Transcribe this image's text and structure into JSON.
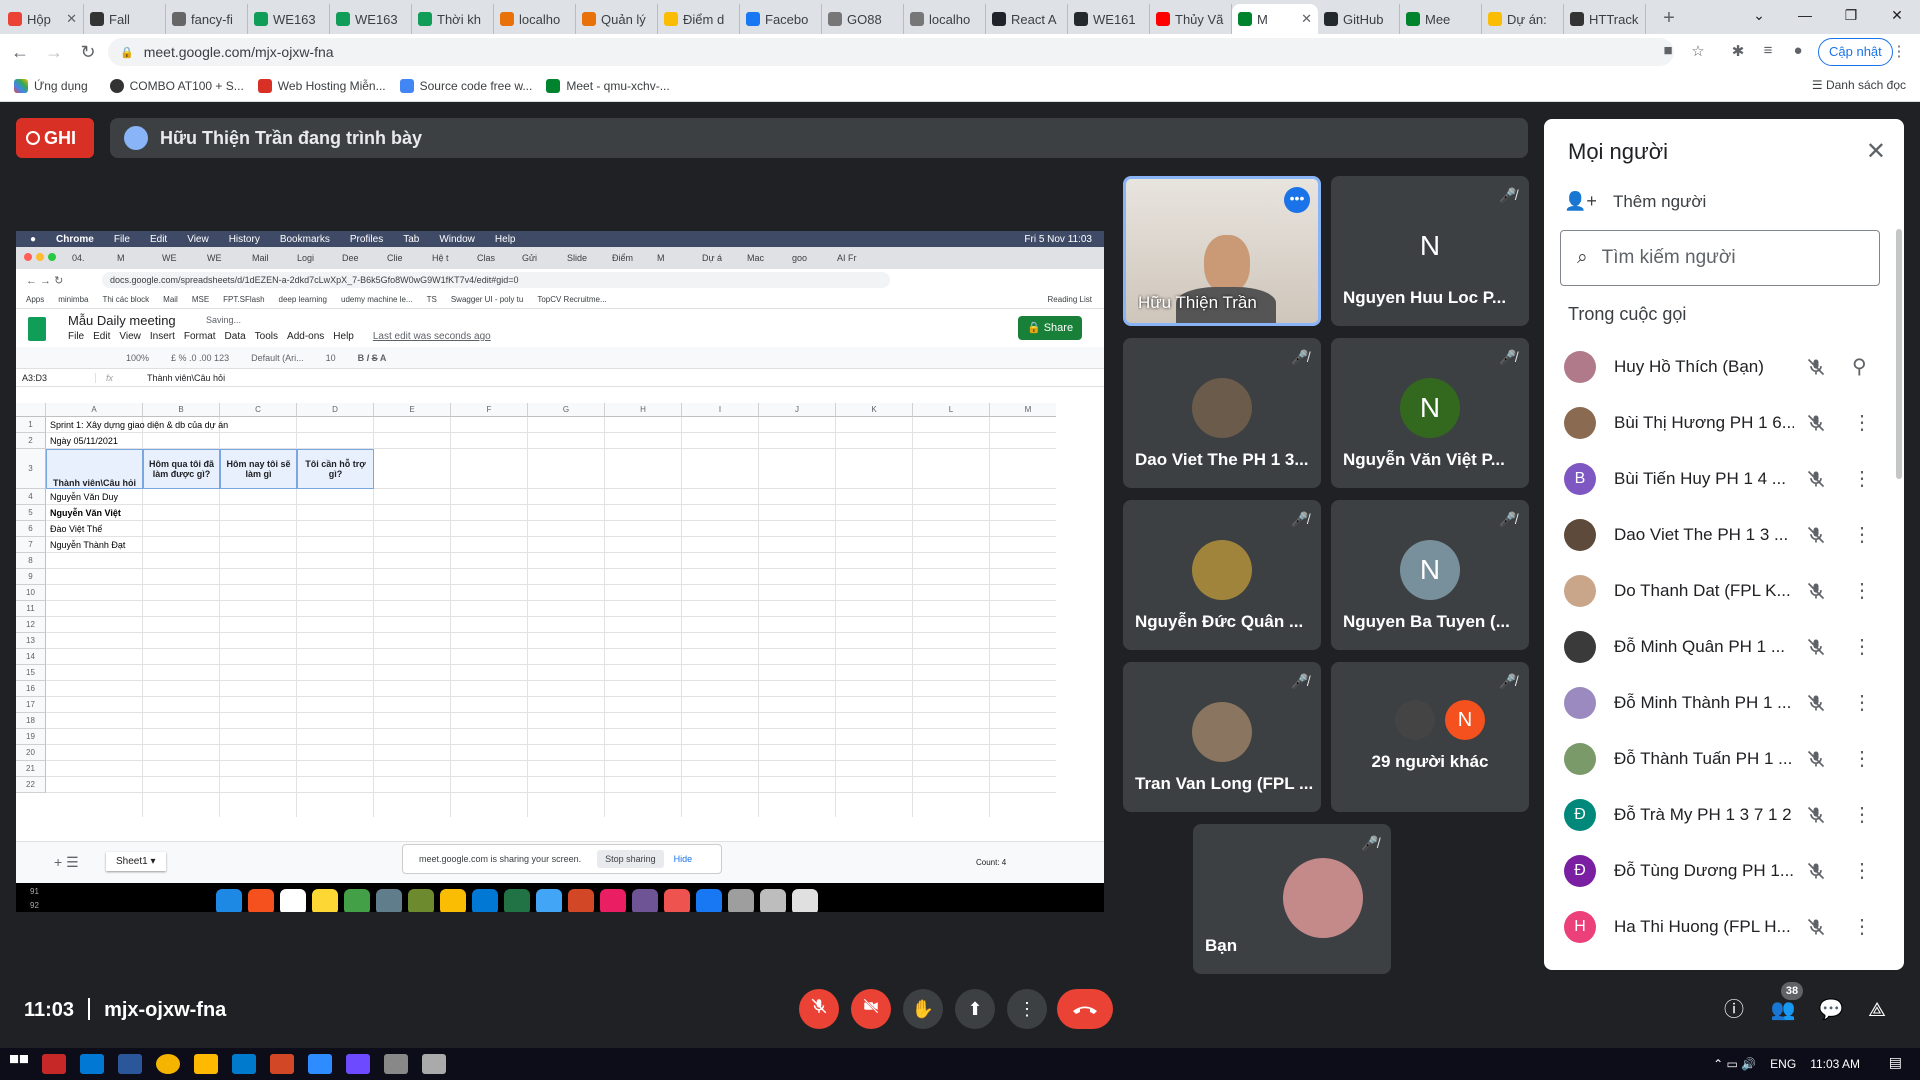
{
  "browser": {
    "tabs": [
      {
        "label": "Hộp",
        "color": "#ea4335"
      },
      {
        "label": "Fall",
        "color": "#333"
      },
      {
        "label": "fancy-fi",
        "color": "#666"
      },
      {
        "label": "WE163",
        "color": "#0f9d58"
      },
      {
        "label": "WE163",
        "color": "#0f9d58"
      },
      {
        "label": "Thời kh",
        "color": "#0f9d58"
      },
      {
        "label": "localho",
        "color": "#e8710a"
      },
      {
        "label": "Quản lý",
        "color": "#e8710a"
      },
      {
        "label": "Điểm d",
        "color": "#fbbc04"
      },
      {
        "label": "Facebo",
        "color": "#1877f2"
      },
      {
        "label": "GO88",
        "color": "#777"
      },
      {
        "label": "localho",
        "color": "#777"
      },
      {
        "label": "React A",
        "color": "#20232a"
      },
      {
        "label": "WE161",
        "color": "#24292e"
      },
      {
        "label": "Thủy Vã",
        "color": "#ff0000"
      },
      {
        "label": "M",
        "color": "#00832d"
      },
      {
        "label": "GitHub",
        "color": "#24292e"
      },
      {
        "label": "Mee",
        "color": "#00832d"
      },
      {
        "label": "Dự án:",
        "color": "#fbbc04"
      },
      {
        "label": "HTTrack",
        "color": "#333"
      }
    ],
    "new_tab": "+",
    "url": "meet.google.com/mjx-ojxw-fna",
    "update_label": "Cập nhật",
    "bookmarks": [
      "Ứng dụng",
      "COMBO AT100 + S...",
      "Web Hosting Miễn...",
      "Source code free w...",
      "Meet - qmu-xchv-..."
    ],
    "reading_list": "Danh sách đọc"
  },
  "meet": {
    "rec_label": "GHI",
    "presenting_text": "Hữu Thiện Trần đang trình bày",
    "meeting_code": "mjx-ojxw-fna",
    "time": "11:03",
    "people_badge": "38",
    "tiles": [
      {
        "name": "Hữu Thiện Trần",
        "initial": "",
        "color": "#8d7a6a"
      },
      {
        "name": "Nguyen Huu Loc P...",
        "initial": "N",
        "color": "#3c4043"
      },
      {
        "name": "Dao Viet The PH 1 3...",
        "initial": "",
        "color": "#6b5b4b"
      },
      {
        "name": "Nguyễn Văn Việt P...",
        "initial": "N",
        "color": "#33691e"
      },
      {
        "name": "Nguyễn Đức Quân ...",
        "initial": "",
        "color": "#a0843c"
      },
      {
        "name": "Nguyen Ba Tuyen (...",
        "initial": "N",
        "color": "#78909c"
      },
      {
        "name": "Tran Van Long (FPL ...",
        "initial": "",
        "color": "#8a7560"
      },
      {
        "name": "29 người khác",
        "initial": "N",
        "color": "#f4511e"
      },
      {
        "name": "Bạn",
        "initial": "",
        "color": "#c48a8a"
      }
    ]
  },
  "people_panel": {
    "title": "Mọi người",
    "add_people": "Thêm người",
    "search_placeholder": "Tìm kiếm người",
    "in_call": "Trong cuộc gọi",
    "people": [
      {
        "name": "Huy Hồ Thích (Bạn)",
        "initial": "",
        "color": "#b07a8a"
      },
      {
        "name": "Bùi Thị Hương PH 1 6...",
        "initial": "",
        "color": "#8a6a50"
      },
      {
        "name": "Bùi Tiến Huy PH 1 4 ...",
        "initial": "B",
        "color": "#7e57c2"
      },
      {
        "name": "Dao Viet The PH 1 3 ...",
        "initial": "",
        "color": "#5d4a3a"
      },
      {
        "name": "Do Thanh Dat (FPL K...",
        "initial": "",
        "color": "#c9a68a"
      },
      {
        "name": "Đỗ Minh Quân PH 1 ...",
        "initial": "",
        "color": "#3a3a3a"
      },
      {
        "name": "Đỗ Minh Thành PH 1 ...",
        "initial": "",
        "color": "#9a8ac0"
      },
      {
        "name": "Đỗ Thành Tuấn PH 1 ...",
        "initial": "",
        "color": "#7a9a6a"
      },
      {
        "name": "Đỗ Trà My PH 1 3 7 1 2",
        "initial": "Đ",
        "color": "#00897b"
      },
      {
        "name": "Đỗ Tùng Dương PH 1...",
        "initial": "Đ",
        "color": "#7b1fa2"
      },
      {
        "name": "Ha Thi Huong (FPL H...",
        "initial": "H",
        "color": "#ec407a"
      }
    ]
  },
  "shared": {
    "mac_menu": [
      "Chrome",
      "File",
      "Edit",
      "View",
      "History",
      "Bookmarks",
      "Profiles",
      "Tab",
      "Window",
      "Help"
    ],
    "mac_clock": "Fri 5 Nov 11:03",
    "inner_url": "docs.google.com/spreadsheets/d/1dEZEN-a-2dkd7cLwXpX_7-B6k5Gfo8W0wG9W1fKT7v4/edit#gid=0",
    "inner_bookmarks": [
      "Apps",
      "minimba",
      "Thi các block",
      "Mail",
      "MSE",
      "FPT.SFlash",
      "deep learning",
      "udemy machine le...",
      "TS",
      "Swagger UI - poly tu",
      "TopCV Recruitme..."
    ],
    "reading_list": "Reading List",
    "sheet_title": "Mẫu Daily meeting",
    "saving": "Saving...",
    "menu": [
      "File",
      "Edit",
      "View",
      "Insert",
      "Format",
      "Data",
      "Tools",
      "Add-ons",
      "Help"
    ],
    "last_edit": "Last edit was seconds ago",
    "share": "Share",
    "zoom": "100%",
    "font": "Default (Ari...",
    "font_size": "10",
    "cell_ref": "A3:D3",
    "formula": "Thành viên\\Câu hỏi",
    "columns": [
      "A",
      "B",
      "C",
      "D",
      "E",
      "F",
      "G",
      "H",
      "I",
      "J",
      "K",
      "L",
      "M"
    ],
    "rows": [
      "1",
      "2",
      "3",
      "4",
      "5",
      "6",
      "7",
      "8",
      "9",
      "10",
      "11",
      "12",
      "13",
      "14",
      "15",
      "16",
      "17",
      "18",
      "19",
      "20",
      "21",
      "22"
    ],
    "row1": "Sprint 1: Xây dựng giao diện & db của dự án",
    "row2": "Ngày 05/11/2021",
    "headers": [
      "Thành viên\\Câu hỏi",
      "Hôm qua tôi đã làm được gì?",
      "Hôm nay tôi sẽ làm gì",
      "Tôi cần hỗ trợ gì?"
    ],
    "members": [
      "Nguyễn Văn Duy",
      "Nguyễn Văn Việt",
      "Đào Việt Thế",
      "Nguyễn Thành Đạt"
    ],
    "sheet_tab": "Sheet1",
    "sharing_text": "meet.google.com is sharing your screen.",
    "stop_sharing": "Stop sharing",
    "hide": "Hide",
    "count": "Count: 4",
    "lower_rows": [
      "91",
      "92"
    ]
  },
  "taskbar": {
    "lang": "ENG",
    "clock": "11:03 AM"
  }
}
